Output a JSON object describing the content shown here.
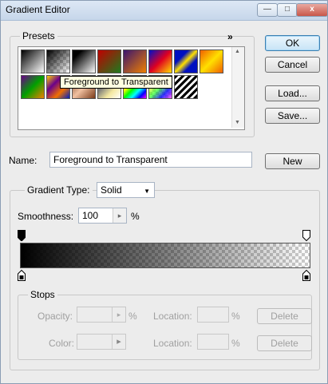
{
  "window": {
    "title": "Gradient Editor",
    "minimize": "—",
    "maximize": "□",
    "close": "x"
  },
  "presets": {
    "label": "Presets",
    "menu_glyph": "»",
    "tooltip": "Foreground to Transparent",
    "scroll_up": "▲",
    "scroll_down": "▼"
  },
  "buttons": {
    "ok": "OK",
    "cancel": "Cancel",
    "load": "Load...",
    "save": "Save...",
    "new": "New"
  },
  "name": {
    "label": "Name:",
    "value": "Foreground to Transparent"
  },
  "gradient_type": {
    "label": "Gradient Type:",
    "value": "Solid",
    "arrow": "▼"
  },
  "smoothness": {
    "label": "Smoothness:",
    "value": "100",
    "unit": "%",
    "arrow": "▸"
  },
  "stops": {
    "label": "Stops",
    "opacity_label": "Opacity:",
    "opacity_unit": "%",
    "color_label": "Color:",
    "location_label": "Location:",
    "location_unit": "%",
    "delete_label": "Delete",
    "arrow": "▸"
  },
  "colors": {
    "accent": "#3c7fb1",
    "tooltip_bg": "#ffffe1"
  },
  "swatch_icons": [
    "black-white-gradient-swatch",
    "foreground-transparent-swatch",
    "black-white-swatch",
    "red-green-swatch",
    "violet-orange-swatch",
    "blue-red-yellow-swatch",
    "blue-yellow-blue-swatch",
    "orange-yellow-orange-swatch",
    "violet-green-orange-swatch",
    "yellow-violet-orange-blue-swatch",
    "copper-swatch",
    "chrome-swatch",
    "spectrum-swatch",
    "transparent-rainbow-swatch",
    "transparent-stripes-swatch"
  ]
}
